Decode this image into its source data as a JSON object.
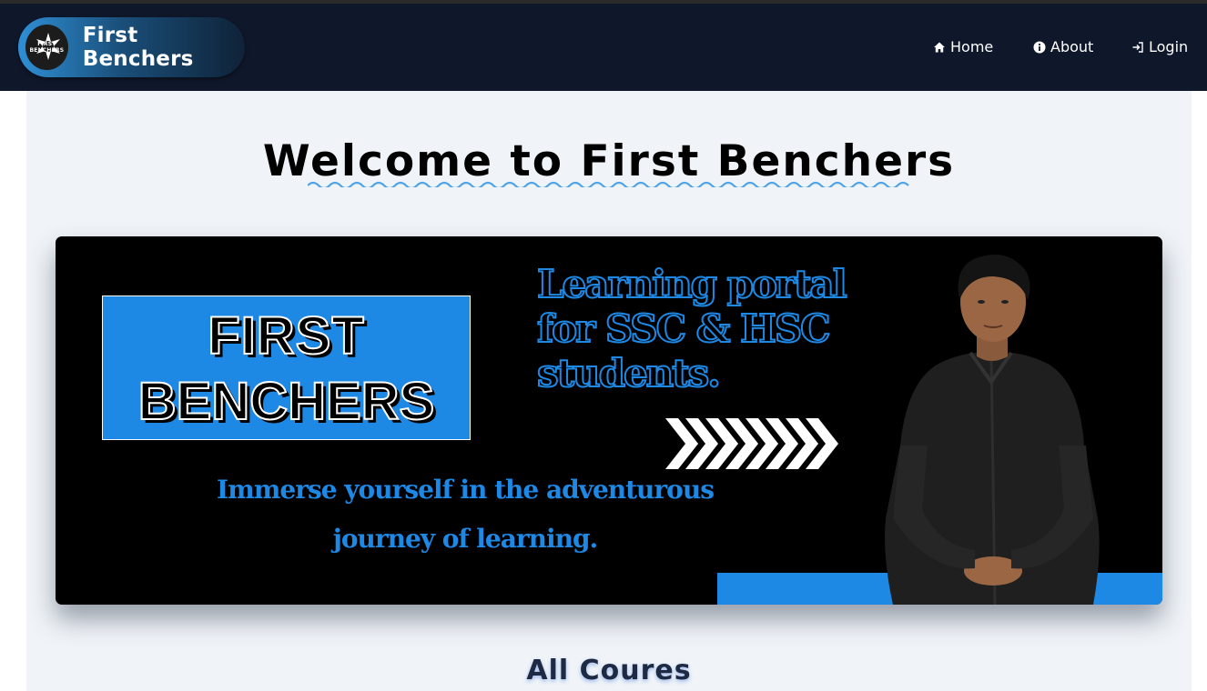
{
  "navbar": {
    "brand_name": "First Benchers",
    "logo_text": "FIRST BENCHERS",
    "links": [
      {
        "label": "Home",
        "icon": "home-icon"
      },
      {
        "label": "About",
        "icon": "info-icon"
      },
      {
        "label": "Login",
        "icon": "login-icon"
      }
    ]
  },
  "main": {
    "welcome_title": "Welcome to First Benchers",
    "banner": {
      "logo_line1": "FIRST",
      "logo_line2": "BENCHERS",
      "tagline_lines": [
        "Learning portal",
        "for SSC & HSC",
        "students."
      ],
      "immerse_line1": "Immerse yourself in the adventurous",
      "immerse_line2": "journey of learning."
    },
    "courses_heading": "All Coures"
  },
  "colors": {
    "navbar_bg": "#0f172a",
    "accent_blue": "#1e88e5",
    "content_bg": "#f0f4f8"
  }
}
